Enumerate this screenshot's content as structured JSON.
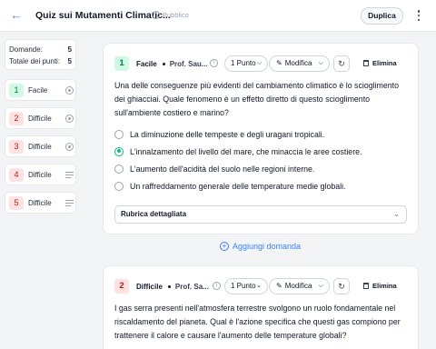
{
  "header": {
    "title": "Quiz sui Mutamenti Climatic...",
    "visibility": "Pubblico",
    "duplicate_label": "Duplica"
  },
  "summary": {
    "questions_label": "Domande:",
    "questions_value": "5",
    "points_label": "Totale dei punti:",
    "points_value": "5"
  },
  "sidebar": {
    "items": [
      {
        "number": "1",
        "label": "Facile",
        "icon": "radio-icon"
      },
      {
        "number": "2",
        "label": "Difficile",
        "icon": "radio-icon"
      },
      {
        "number": "3",
        "label": "Difficile",
        "icon": "radio-icon"
      },
      {
        "number": "4",
        "label": "Difficile",
        "icon": "lines-icon"
      },
      {
        "number": "5",
        "label": "Difficile",
        "icon": "lines-icon"
      }
    ]
  },
  "questions": [
    {
      "number": "1",
      "difficulty": "Facile",
      "author": "Prof. Sau...",
      "points": "1 Punto",
      "edit_label": "Modifica",
      "delete_label": "Elimina",
      "text": "Una delle conseguenze più evidenti del cambiamento climatico è lo scioglimento dei ghiacciai. Quale fenomeno è un effetto diretto di questo scioglimento sull'ambiente costiero e marino?",
      "options": [
        "La diminuzione delle tempeste e degli uragani tropicali.",
        "L'innalzamento del livello del mare, che minaccia le aree costiere.",
        "L'aumento dell'acidità del suolo nelle regioni interne.",
        "Un raffreddamento generale delle temperature medie globali."
      ],
      "selected_option": 1,
      "rubric_label": "Rubrica dettagliata"
    },
    {
      "number": "2",
      "difficulty": "Difficile",
      "author": "Prof. Sa...",
      "points": "1 Punto",
      "edit_label": "Modifica",
      "delete_label": "Elimina",
      "text": "I gas serra presenti nell'atmosfera terrestre svolgono un ruolo fondamentale nel riscaldamento del pianeta. Qual è l'azione specifica che questi gas compiono per trattenere il calore e causare l'aumento delle temperature globali?"
    }
  ],
  "add_question_label": "Aggiungi domanda",
  "colors": {
    "accent": "#3b82f6",
    "easy_bg": "#d1fae5",
    "hard_bg": "#fee2e2",
    "selected": "#10b981"
  }
}
